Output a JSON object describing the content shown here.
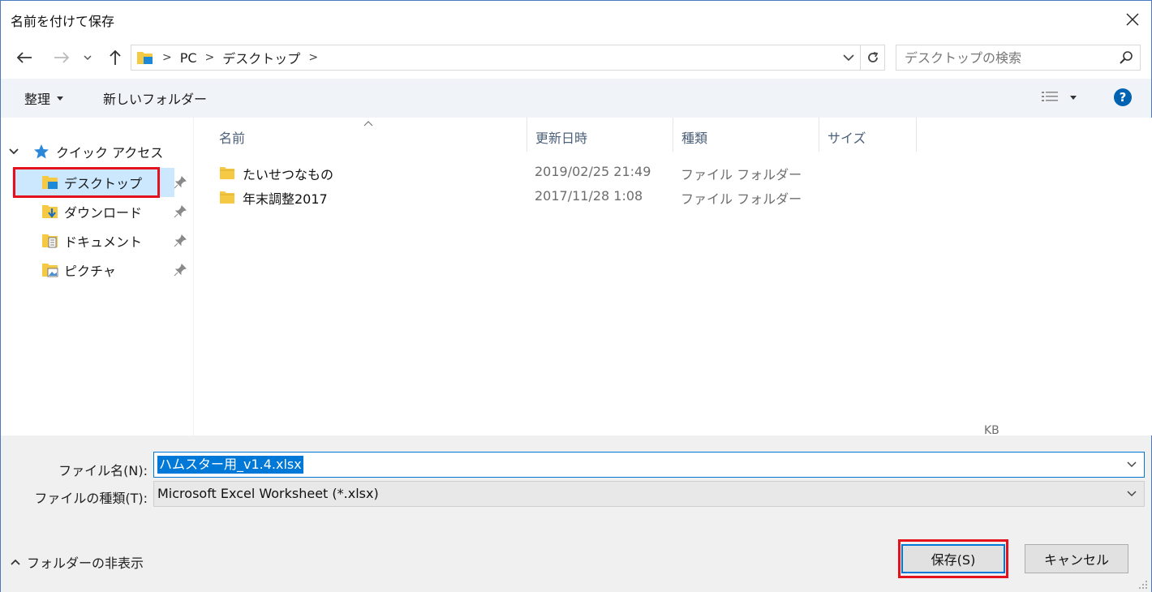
{
  "window": {
    "title": "名前を付けて保存"
  },
  "address": {
    "segments": [
      "PC",
      "デスクトップ"
    ],
    "search_placeholder": "デスクトップの検索"
  },
  "toolbar": {
    "organize_label": "整理",
    "new_folder_label": "新しいフォルダー",
    "help_label": "?"
  },
  "sidebar": {
    "quick_access_label": "クイック アクセス",
    "items": [
      {
        "label": "デスクトップ",
        "icon": "desktop-folder-icon",
        "selected": true
      },
      {
        "label": "ダウンロード",
        "icon": "download-folder-icon",
        "selected": false
      },
      {
        "label": "ドキュメント",
        "icon": "document-folder-icon",
        "selected": false
      },
      {
        "label": "ピクチャ",
        "icon": "picture-folder-icon",
        "selected": false
      }
    ]
  },
  "filelist": {
    "columns": [
      "名前",
      "更新日時",
      "種類",
      "サイズ"
    ],
    "rows": [
      {
        "name": "たいせつなもの",
        "date": "2019/02/25 21:49",
        "type": "ファイル フォルダー"
      },
      {
        "name": "年末調整2017",
        "date": "2017/11/28 1:08",
        "type": "ファイル フォルダー"
      }
    ],
    "size_unit_fragment": "KB"
  },
  "bottom": {
    "file_name_label": "ファイル名(N):",
    "file_name_value": "ハムスター用_v1.4.xlsx",
    "file_type_label": "ファイルの種類(T):",
    "file_type_value": "Microsoft Excel Worksheet (*.xlsx)",
    "hide_folders_label": "フォルダーの非表示",
    "save_label": "保存(S)",
    "cancel_label": "キャンセル"
  },
  "colors": {
    "accent": "#0078d7",
    "highlight": "#e3121c",
    "selection": "#cce8ff",
    "toolbar_bg": "#f0f4f9",
    "help_blue": "#0063b1",
    "folder_yellow": "#f5c944"
  }
}
